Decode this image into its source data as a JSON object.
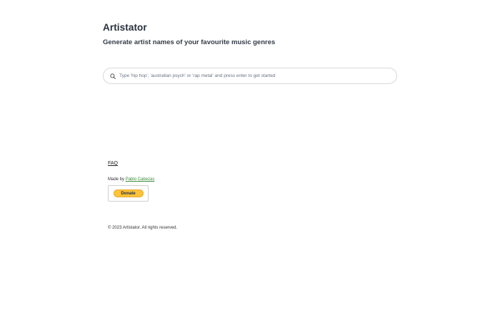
{
  "header": {
    "title": "Artistator",
    "subtitle": "Generate artist names of your favourite music genres"
  },
  "search": {
    "icon": "search-icon",
    "value": "",
    "placeholder": "Type 'hip hop', 'australian psych' or 'rap metal' and press enter to get started"
  },
  "footer": {
    "faq_label": "FAQ",
    "made_by_prefix": "Made by",
    "author_name": "Pablo Cabezas",
    "donate_label": "Donate",
    "copyright": "© 2023 Artistator. All rights reserved."
  },
  "colors": {
    "author_link": "#3c8a3c",
    "donate_button": "#ffc439",
    "title_text": "#27303b"
  }
}
